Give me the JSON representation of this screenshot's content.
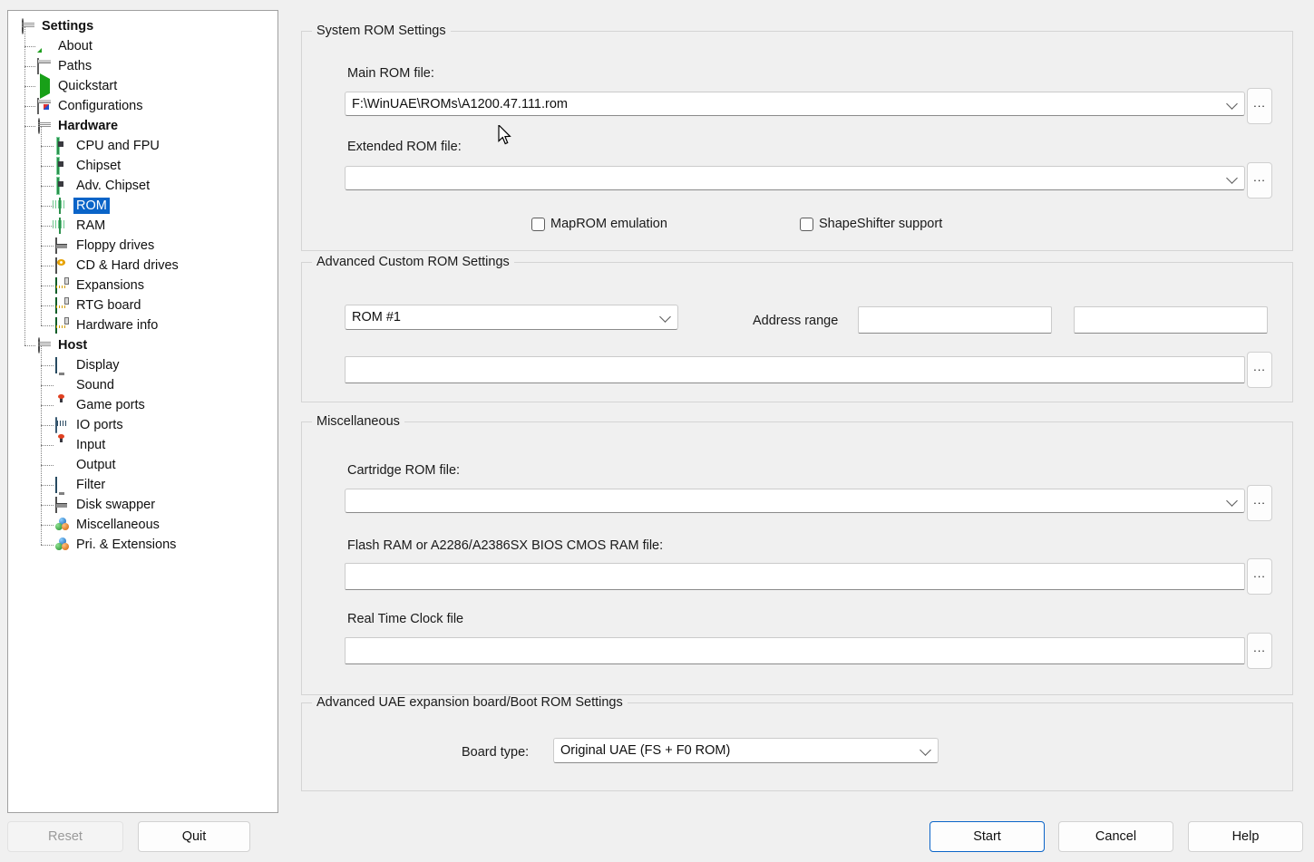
{
  "window": {
    "background": "#f0f0f0",
    "accent": "#0a64c8"
  },
  "sidebar": {
    "items": [
      {
        "label": "Settings",
        "icon": "disk-stack-icon",
        "level": 0,
        "bold": true,
        "selected": false
      },
      {
        "label": "About",
        "icon": "pencil-icon",
        "level": 1,
        "bold": false,
        "selected": false
      },
      {
        "label": "Paths",
        "icon": "window-icon",
        "level": 1,
        "bold": false,
        "selected": false
      },
      {
        "label": "Quickstart",
        "icon": "play-icon",
        "level": 1,
        "bold": false,
        "selected": false
      },
      {
        "label": "Configurations",
        "icon": "config-window-icon",
        "level": 1,
        "bold": false,
        "selected": false
      },
      {
        "label": "Hardware",
        "icon": "disk-stack-icon",
        "level": 1,
        "bold": true,
        "selected": false
      },
      {
        "label": "CPU and FPU",
        "icon": "chip-icon",
        "level": 2,
        "bold": false,
        "selected": false
      },
      {
        "label": "Chipset",
        "icon": "chip-icon",
        "level": 2,
        "bold": false,
        "selected": false
      },
      {
        "label": "Adv. Chipset",
        "icon": "chip-icon",
        "level": 2,
        "bold": false,
        "selected": false
      },
      {
        "label": "ROM",
        "icon": "ram-stick-icon",
        "level": 2,
        "bold": false,
        "selected": true
      },
      {
        "label": "RAM",
        "icon": "ram-stick-icon",
        "level": 2,
        "bold": false,
        "selected": false
      },
      {
        "label": "Floppy drives",
        "icon": "floppy-icon",
        "level": 2,
        "bold": false,
        "selected": false
      },
      {
        "label": "CD & Hard drives",
        "icon": "cd-drive-icon",
        "level": 2,
        "bold": false,
        "selected": false
      },
      {
        "label": "Expansions",
        "icon": "expansion-card-icon",
        "level": 2,
        "bold": false,
        "selected": false
      },
      {
        "label": "RTG board",
        "icon": "expansion-card-icon",
        "level": 2,
        "bold": false,
        "selected": false
      },
      {
        "label": "Hardware info",
        "icon": "expansion-card-icon",
        "level": 2,
        "bold": false,
        "selected": false
      },
      {
        "label": "Host",
        "icon": "disk-stack-icon",
        "level": 1,
        "bold": true,
        "selected": false
      },
      {
        "label": "Display",
        "icon": "monitor-icon",
        "level": 2,
        "bold": false,
        "selected": false
      },
      {
        "label": "Sound",
        "icon": "speaker-icon",
        "level": 2,
        "bold": false,
        "selected": false
      },
      {
        "label": "Game ports",
        "icon": "joystick-icon",
        "level": 2,
        "bold": false,
        "selected": false
      },
      {
        "label": "IO ports",
        "icon": "io-ports-icon",
        "level": 2,
        "bold": false,
        "selected": false
      },
      {
        "label": "Input",
        "icon": "joystick-icon",
        "level": 2,
        "bold": false,
        "selected": false
      },
      {
        "label": "Output",
        "icon": "speaker-icon",
        "level": 2,
        "bold": false,
        "selected": false
      },
      {
        "label": "Filter",
        "icon": "monitor-icon",
        "level": 2,
        "bold": false,
        "selected": false
      },
      {
        "label": "Disk swapper",
        "icon": "floppy-icon",
        "level": 2,
        "bold": false,
        "selected": false
      },
      {
        "label": "Miscellaneous",
        "icon": "spheres-icon",
        "level": 2,
        "bold": false,
        "selected": false
      },
      {
        "label": "Pri. & Extensions",
        "icon": "spheres-icon",
        "level": 2,
        "bold": false,
        "selected": false
      }
    ]
  },
  "system_rom": {
    "group_title": "System ROM Settings",
    "main_rom_label": "Main ROM file:",
    "main_rom_value": "F:\\WinUAE\\ROMs\\A1200.47.111.rom",
    "extended_rom_label": "Extended ROM file:",
    "extended_rom_value": "",
    "browse_label": "...",
    "maprom_label": "MapROM emulation",
    "maprom_checked": false,
    "shapeshifter_label": "ShapeShifter support",
    "shapeshifter_checked": false
  },
  "advanced_custom_rom": {
    "group_title": "Advanced Custom ROM Settings",
    "rom_select_value": "ROM #1",
    "address_range_label": "Address range",
    "address_start_value": "",
    "address_end_value": "",
    "rom_path_value": "",
    "browse_label": "..."
  },
  "miscellaneous": {
    "group_title": "Miscellaneous",
    "cartridge_label": "Cartridge ROM file:",
    "cartridge_value": "",
    "flash_label": "Flash RAM or A2286/A2386SX BIOS CMOS RAM file:",
    "flash_value": "",
    "rtc_label": "Real Time Clock file",
    "rtc_value": "",
    "browse_label": "..."
  },
  "uae_board": {
    "group_title": "Advanced UAE expansion board/Boot ROM Settings",
    "board_type_label": "Board type:",
    "board_type_value": "Original UAE (FS + F0 ROM)"
  },
  "footer": {
    "reset_label": "Reset",
    "reset_disabled": true,
    "quit_label": "Quit",
    "start_label": "Start",
    "cancel_label": "Cancel",
    "help_label": "Help"
  }
}
